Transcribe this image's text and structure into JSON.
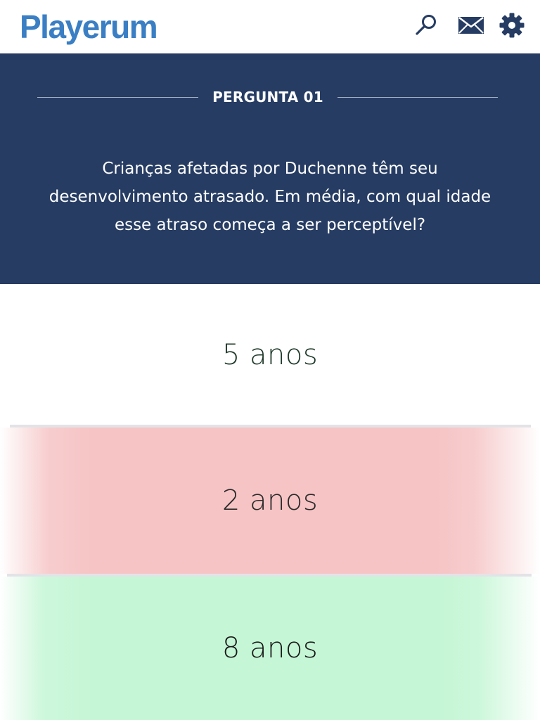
{
  "header": {
    "logo_text": "Playerum",
    "icons": [
      "search-icon",
      "mail-icon",
      "gear-icon"
    ],
    "colors": {
      "logo": "#3a7fc4",
      "icons": "#263c63"
    }
  },
  "question": {
    "number_label": "PERGUNTA 01",
    "text": "Crianças afetadas por Duchenne têm seu desenvolvimento atrasado. Em média, com qual idade esse atraso começa a ser perceptível?",
    "colors": {
      "background": "#263c63",
      "text": "#ffffff"
    }
  },
  "answers": [
    {
      "label": "5 anos",
      "state": "neutral",
      "color": "#ffffff"
    },
    {
      "label": "2 anos",
      "state": "wrong",
      "color": "#f6c4c5"
    },
    {
      "label": "8 anos",
      "state": "correct",
      "color": "#c5f6d5"
    }
  ]
}
